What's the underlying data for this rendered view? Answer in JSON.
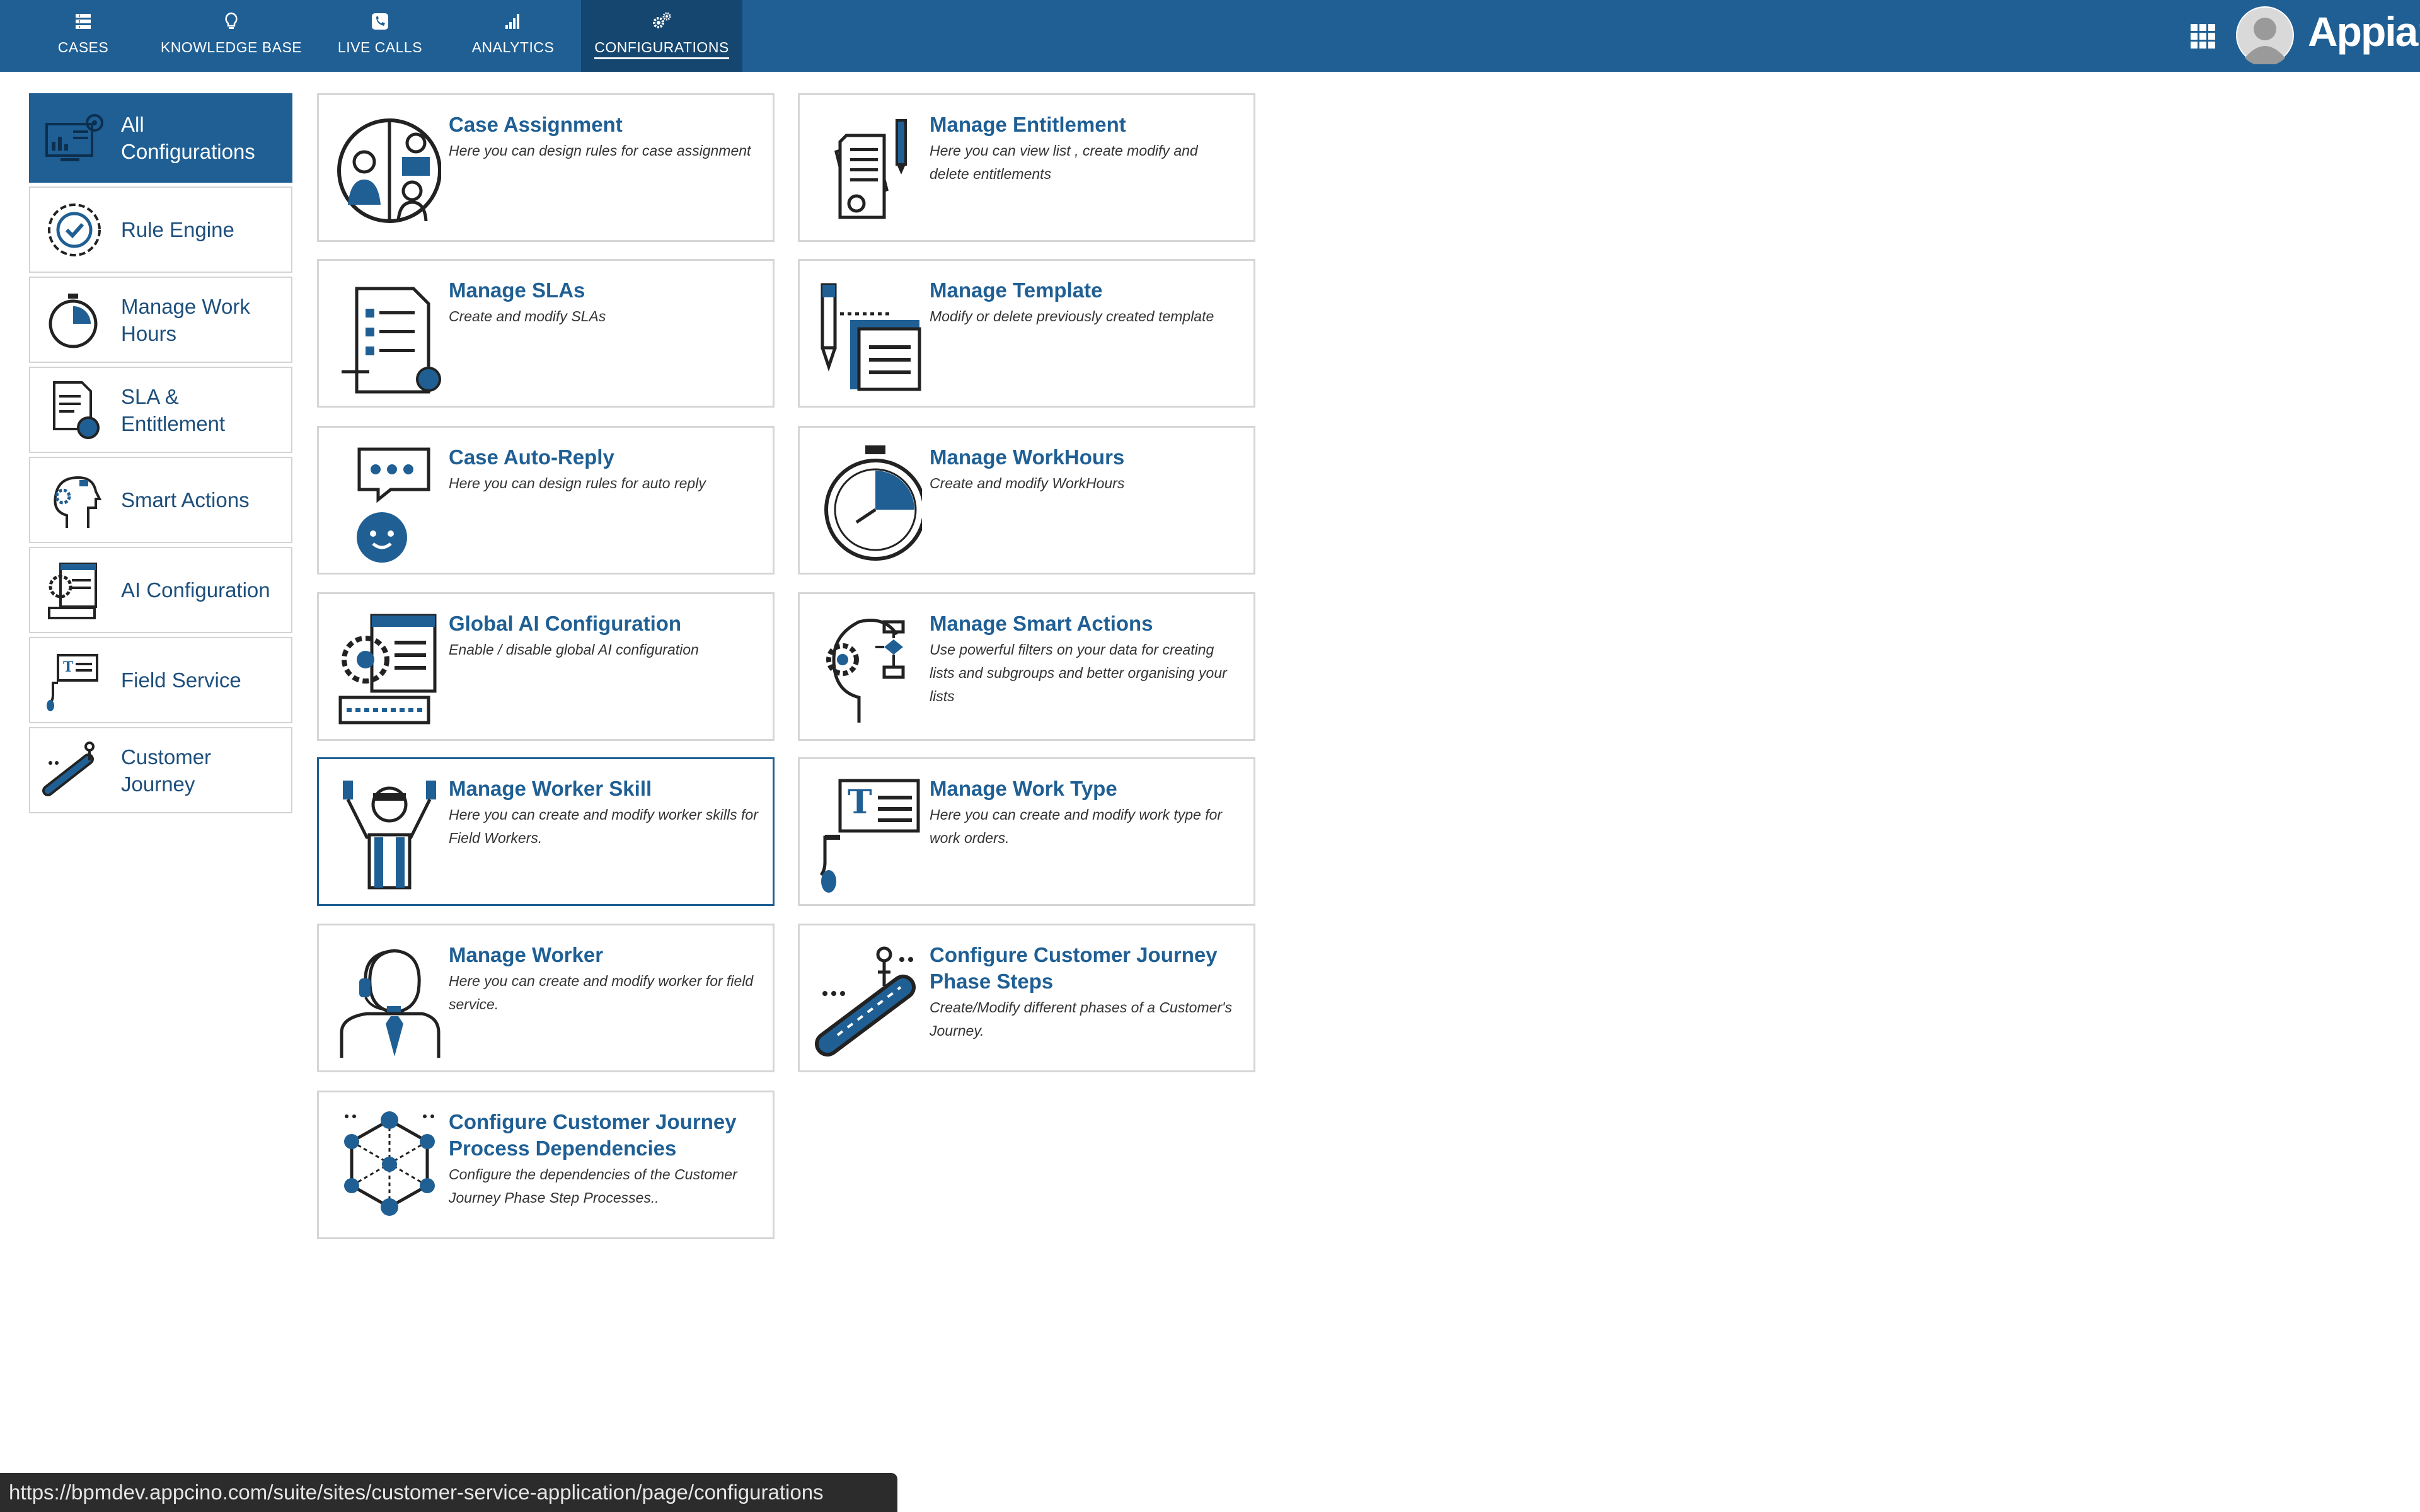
{
  "header": {
    "tabs": [
      {
        "label": "CASES",
        "icon": "list-icon"
      },
      {
        "label": "KNOWLEDGE BASE",
        "icon": "lightbulb-icon"
      },
      {
        "label": "LIVE CALLS",
        "icon": "phone-icon"
      },
      {
        "label": "ANALYTICS",
        "icon": "bar-chart-icon"
      },
      {
        "label": "CONFIGURATIONS",
        "icon": "gears-icon"
      }
    ],
    "active_tab": "CONFIGURATIONS",
    "brand": "Appian"
  },
  "sidebar": {
    "items": [
      {
        "label": "All Configurations",
        "icon": "dashboard-monitor-icon",
        "active": true
      },
      {
        "label": "Rule Engine",
        "icon": "gear-check-icon"
      },
      {
        "label": "Manage Work Hours",
        "icon": "stopwatch-icon"
      },
      {
        "label": "SLA & Entitlement",
        "icon": "document-clock-icon"
      },
      {
        "label": "Smart Actions",
        "icon": "head-gear-icon"
      },
      {
        "label": "AI Configuration",
        "icon": "ai-document-icon"
      },
      {
        "label": "Field Service",
        "icon": "presentation-icon"
      },
      {
        "label": "Customer Journey",
        "icon": "escalator-icon"
      }
    ]
  },
  "cards": [
    {
      "title": "Case Assignment",
      "desc": "Here you can design rules for case assignment",
      "icon": "people-circle-icon"
    },
    {
      "title": "Manage Entitlement",
      "desc": "Here you can view list , create modify and delete entitlements",
      "icon": "certificate-pen-icon"
    },
    {
      "title": "Manage SLAs",
      "desc": "Create and modify SLAs",
      "icon": "checklist-document-icon"
    },
    {
      "title": "Manage Template",
      "desc": "Modify or delete previously created template",
      "icon": "pencil-template-icon"
    },
    {
      "title": "Case Auto-Reply",
      "desc": "Here you can design rules for auto reply",
      "icon": "chat-bot-icon"
    },
    {
      "title": "Manage WorkHours",
      "desc": "Create and modify WorkHours",
      "icon": "stopwatch-icon"
    },
    {
      "title": "Global AI Configuration",
      "desc": "Enable / disable global AI configuration",
      "icon": "ai-gear-document-icon"
    },
    {
      "title": "Manage Smart Actions",
      "desc": "Use powerful filters on your data for creating lists and subgroups and better organising your lists",
      "icon": "head-gear-flow-icon"
    },
    {
      "title": "Manage Worker Skill",
      "desc": "Here you can create and modify worker skills for Field Workers.",
      "icon": "worker-icon",
      "selected": true
    },
    {
      "title": "Manage Work Type",
      "desc": "Here you can create and modify work type for work orders.",
      "icon": "presentation-board-icon"
    },
    {
      "title": "Manage Worker",
      "desc": "Here you can create and modify worker for field service.",
      "icon": "support-agent-icon"
    },
    {
      "title": "Configure Customer Journey Phase Steps",
      "desc": "Create/Modify different phases of a Customer's Journey.",
      "icon": "escalator-person-icon"
    },
    {
      "title": "Configure Customer Journey Process Dependencies",
      "desc": "Configure the dependencies of the Customer Journey Phase Step Processes..",
      "icon": "network-cube-icon"
    }
  ],
  "statusbar": {
    "url": "https://bpmdev.appcino.com/suite/sites/customer-service-application/page/configurations"
  },
  "colors": {
    "primary": "#1f5f94",
    "primary_dark": "#14466f",
    "border": "#d6d6d6",
    "text_dark": "#333333"
  }
}
